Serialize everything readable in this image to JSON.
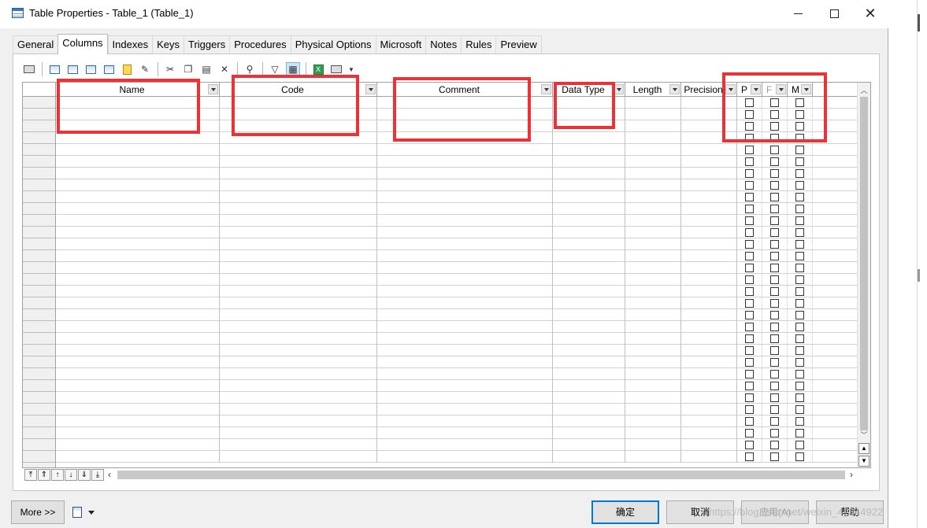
{
  "window": {
    "title": "Table Properties - Table_1 (Table_1)"
  },
  "tabs": [
    "General",
    "Columns",
    "Indexes",
    "Keys",
    "Triggers",
    "Procedures",
    "Physical Options",
    "Microsoft",
    "Notes",
    "Rules",
    "Preview"
  ],
  "active_tab": "Columns",
  "toolbar": {
    "icons": [
      "properties-icon",
      "insert-row-icon",
      "add-row-icon",
      "add-columns-icon",
      "reuse-columns-icon",
      "find-icon",
      "cut-icon",
      "copy-icon",
      "paste-icon",
      "delete-icon",
      "search-icon",
      "filter-icon",
      "excel-export-icon",
      "print-icon"
    ]
  },
  "grid": {
    "columns": [
      {
        "key": "name",
        "label": "Name"
      },
      {
        "key": "code",
        "label": "Code"
      },
      {
        "key": "comment",
        "label": "Comment"
      },
      {
        "key": "datatype",
        "label": "Data Type"
      },
      {
        "key": "length",
        "label": "Length"
      },
      {
        "key": "precision",
        "label": "Precision"
      },
      {
        "key": "p",
        "label": "P"
      },
      {
        "key": "f",
        "label": "F"
      },
      {
        "key": "m",
        "label": "M"
      }
    ],
    "row_count": 31
  },
  "footer": {
    "more_label": "More >>",
    "ok_label": "确定",
    "cancel_label": "取消",
    "apply_label": "应用(A)",
    "help_label": "帮助"
  },
  "watermark": "https://blog.csdn.net/weixin_42844922",
  "colors": {
    "highlight_box": "#ec3237",
    "default_button_border": "#0078d7"
  }
}
